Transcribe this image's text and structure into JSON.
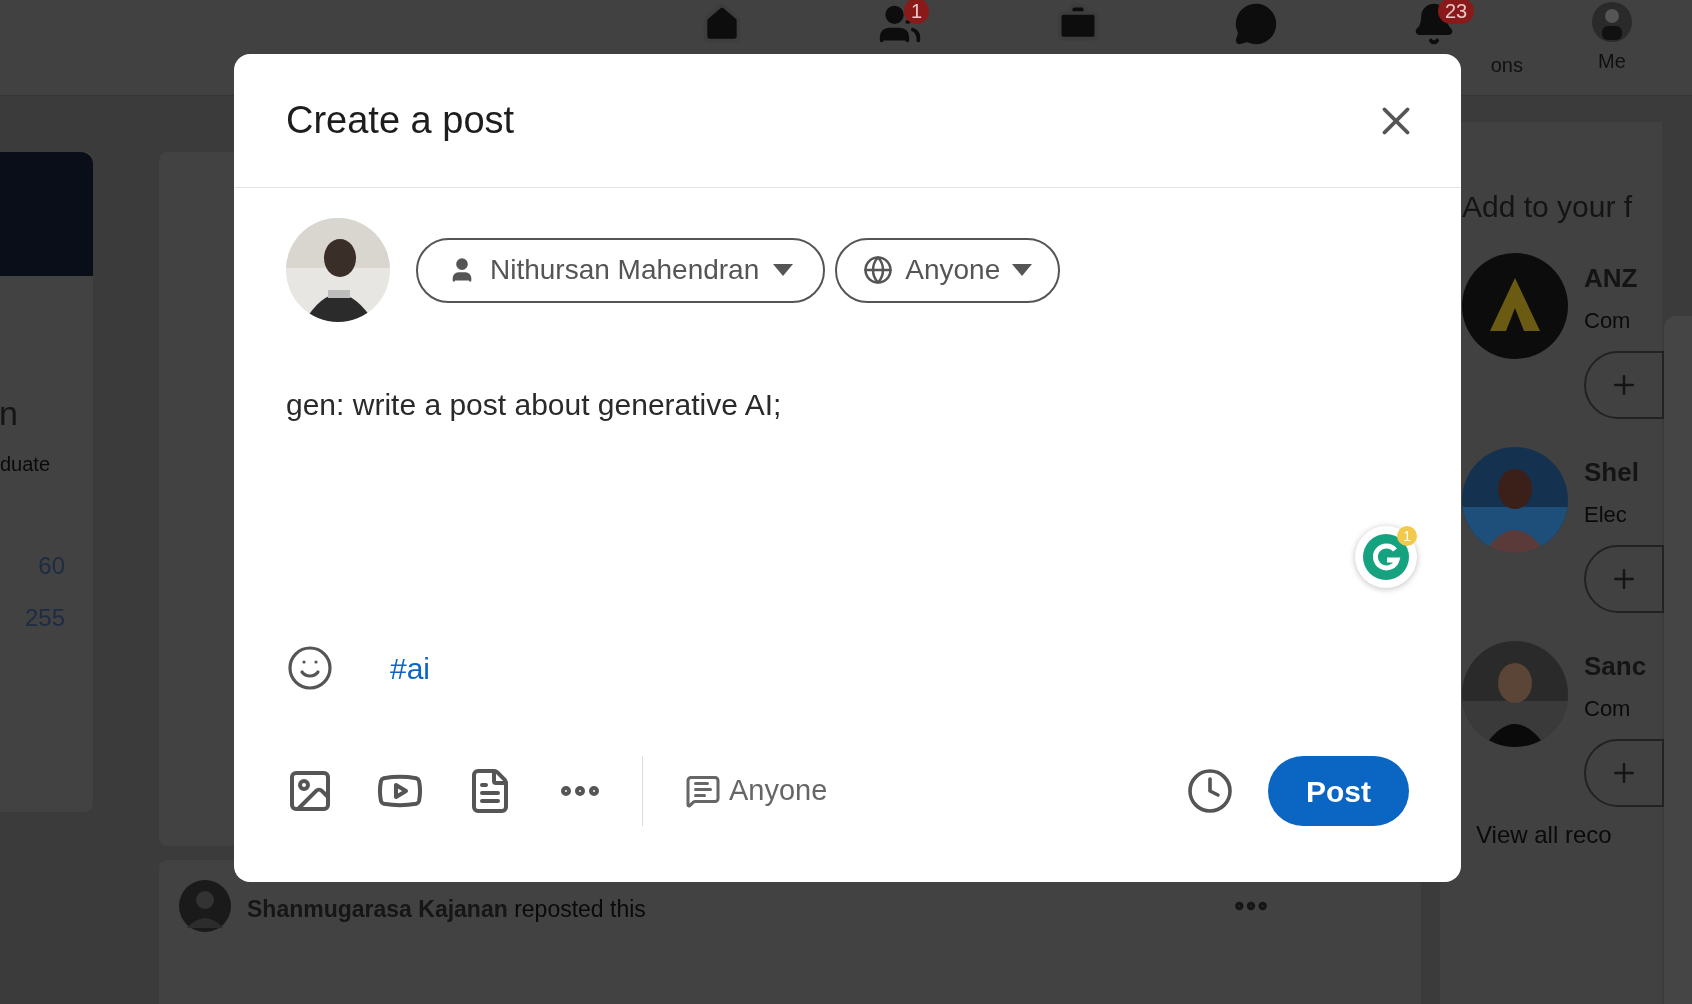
{
  "nav_items": [
    {
      "kind": "home"
    },
    {
      "kind": "network",
      "badge": "1"
    },
    {
      "kind": "jobs"
    },
    {
      "kind": "messaging"
    },
    {
      "kind": "notifications",
      "badge": "23",
      "label": "ons"
    },
    {
      "kind": "me",
      "label": "Me"
    }
  ],
  "left_card": {
    "name_fragment": "n",
    "headline_fragment": "duate",
    "stats": [
      "60",
      "255"
    ]
  },
  "right_panel": {
    "title": "Add to your f",
    "suggestions": [
      {
        "name": "ANZ",
        "subtitle": "Com"
      },
      {
        "name": "Shel",
        "subtitle": "Elec"
      },
      {
        "name": "Sanc",
        "subtitle": "Com"
      }
    ],
    "view_all": "View all reco"
  },
  "feed_item": {
    "author": "Shanmugarasa Kajanan",
    "action": "reposted this"
  },
  "modal": {
    "title": "Create a post",
    "author_button": "Nithursan Mahendran",
    "visibility_button": "Anyone",
    "text": "gen: write a post about generative AI;",
    "grammarly_badge": "1",
    "hashtag": "#ai",
    "comment_control": "Anyone",
    "post_button": "Post"
  }
}
